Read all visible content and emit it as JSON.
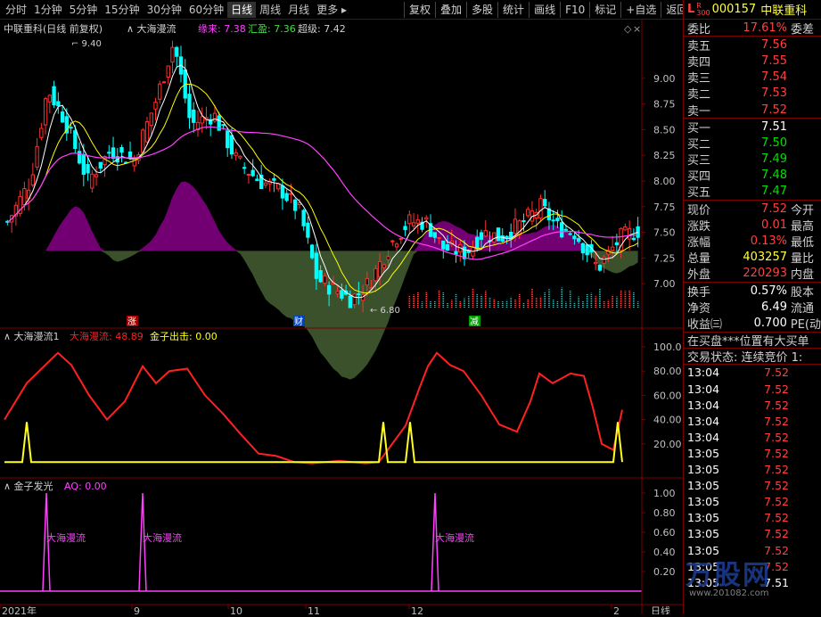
{
  "toolbar": {
    "periods": [
      "分时",
      "1分钟",
      "5分钟",
      "15分钟",
      "30分钟",
      "60分钟",
      "日线",
      "周线",
      "月线",
      "更多"
    ],
    "active_period": "日线",
    "buttons": [
      "复权",
      "叠加",
      "多股",
      "统计",
      "画线",
      "F10",
      "标记",
      "+自选",
      "返回"
    ]
  },
  "panel1": {
    "title": "中联重科(日线 前复权)",
    "indicator": "大海漫流",
    "legend": [
      {
        "label": "缘来: 7.38",
        "color": "#ff40ff"
      },
      {
        "label": "汇盈: 7.36",
        "color": "#40e040"
      },
      {
        "label": "超级: 7.42",
        "color": "#d0d0d0"
      }
    ],
    "high_label": "9.40",
    "low_label": "6.80",
    "y_ticks": [
      "9.00",
      "8.75",
      "8.50",
      "8.25",
      "8.00",
      "7.75",
      "7.50",
      "7.25",
      "7.00"
    ],
    "markers": [
      {
        "text": "涨",
        "bg": "#a00000",
        "color": "#ffffff"
      },
      {
        "text": "财",
        "bg": "#0040c0",
        "color": "#ffffff"
      },
      {
        "text": "减",
        "bg": "#00a000",
        "color": "#ffffff"
      }
    ]
  },
  "panel2": {
    "title": "大海漫流1",
    "legend": [
      {
        "label": "大海漫流: 48.89",
        "color": "#ff2020"
      },
      {
        "label": "金子出击: 0.00",
        "color": "#ffff20"
      }
    ],
    "y_ticks": [
      "100.0",
      "80.00",
      "60.00",
      "40.00",
      "20.00"
    ]
  },
  "panel3": {
    "title": "金子发光",
    "legend": [
      {
        "label": "AQ: 0.00",
        "color": "#ff40ff"
      }
    ],
    "y_ticks": [
      "1.00",
      "0.80",
      "0.60",
      "0.40",
      "0.20"
    ],
    "signal_label": "大海漫流"
  },
  "x_axis": {
    "labels": [
      "2021年",
      "9",
      "10",
      "11",
      "12",
      "2"
    ],
    "period_tag": "日线"
  },
  "quote": {
    "market_tag_l": "L",
    "market_tag_r": "R",
    "market_tag_n": "300",
    "code": "000157",
    "name": "中联重科",
    "webi": {
      "label": "委比",
      "value": "17.61%",
      "tail": "委差"
    },
    "sells": [
      {
        "label": "卖五",
        "price": "7.56"
      },
      {
        "label": "卖四",
        "price": "7.55"
      },
      {
        "label": "卖三",
        "price": "7.54"
      },
      {
        "label": "卖二",
        "price": "7.53"
      },
      {
        "label": "卖一",
        "price": "7.52"
      }
    ],
    "buys": [
      {
        "label": "买一",
        "price": "7.51",
        "cls": "white"
      },
      {
        "label": "买二",
        "price": "7.50",
        "cls": "green"
      },
      {
        "label": "买三",
        "price": "7.49",
        "cls": "green"
      },
      {
        "label": "买四",
        "price": "7.48",
        "cls": "green"
      },
      {
        "label": "买五",
        "price": "7.47",
        "cls": "green"
      }
    ],
    "stats": [
      {
        "label": "现价",
        "value": "7.52",
        "cls": "red",
        "tail": "今开"
      },
      {
        "label": "涨跌",
        "value": "0.01",
        "cls": "red",
        "tail": "最高"
      },
      {
        "label": "涨幅",
        "value": "0.13%",
        "cls": "red",
        "tail": "最低"
      },
      {
        "label": "总量",
        "value": "403257",
        "cls": "yellow",
        "tail": "量比"
      },
      {
        "label": "外盘",
        "value": "220293",
        "cls": "red",
        "tail": "内盘"
      }
    ],
    "stats2": [
      {
        "label": "换手",
        "value": "0.57%",
        "cls": "white",
        "tail": "股本"
      },
      {
        "label": "净资",
        "value": "6.49",
        "cls": "white",
        "tail": "流通"
      },
      {
        "label": "收益㈢",
        "value": "0.700",
        "cls": "white",
        "tail": "PE(动"
      }
    ],
    "notice1": "在买盘***位置有大买单",
    "notice2": "交易状态: 连续竞价 1:",
    "ticks": [
      {
        "time": "13:04",
        "price": "7.52",
        "flag": "B"
      },
      {
        "time": "13:04",
        "price": "7.52",
        "flag": "B"
      },
      {
        "time": "13:04",
        "price": "7.52",
        "flag": "B"
      },
      {
        "time": "13:04",
        "price": "7.52",
        "flag": "B"
      },
      {
        "time": "13:04",
        "price": "7.52",
        "flag": "B"
      },
      {
        "time": "13:05",
        "price": "7.52",
        "flag": "B"
      },
      {
        "time": "13:05",
        "price": "7.52",
        "flag": "B"
      },
      {
        "time": "13:05",
        "price": "7.52",
        "flag": "B"
      },
      {
        "time": "13:05",
        "price": "7.52",
        "flag": "B"
      },
      {
        "time": "13:05",
        "price": "7.52",
        "flag": "B"
      },
      {
        "time": "13:05",
        "price": "7.52",
        "flag": "B"
      },
      {
        "time": "13:05",
        "price": "7.52",
        "flag": "B"
      },
      {
        "time": "13:05",
        "price": "7.52",
        "flag": "B"
      },
      {
        "time": "13:05",
        "price": "7.51",
        "flag": ""
      }
    ],
    "watermark": "万股网",
    "watermark_sub": "www.201082.com"
  },
  "colors": {
    "up": "#ff3030",
    "down": "#00ffff",
    "ma_fast": "#ffffff",
    "ma_mid": "#ffff00",
    "ma_slow": "#ff40ff",
    "fill_pos": "#800080",
    "fill_neg": "#405a30",
    "border": "#7a0000"
  }
}
